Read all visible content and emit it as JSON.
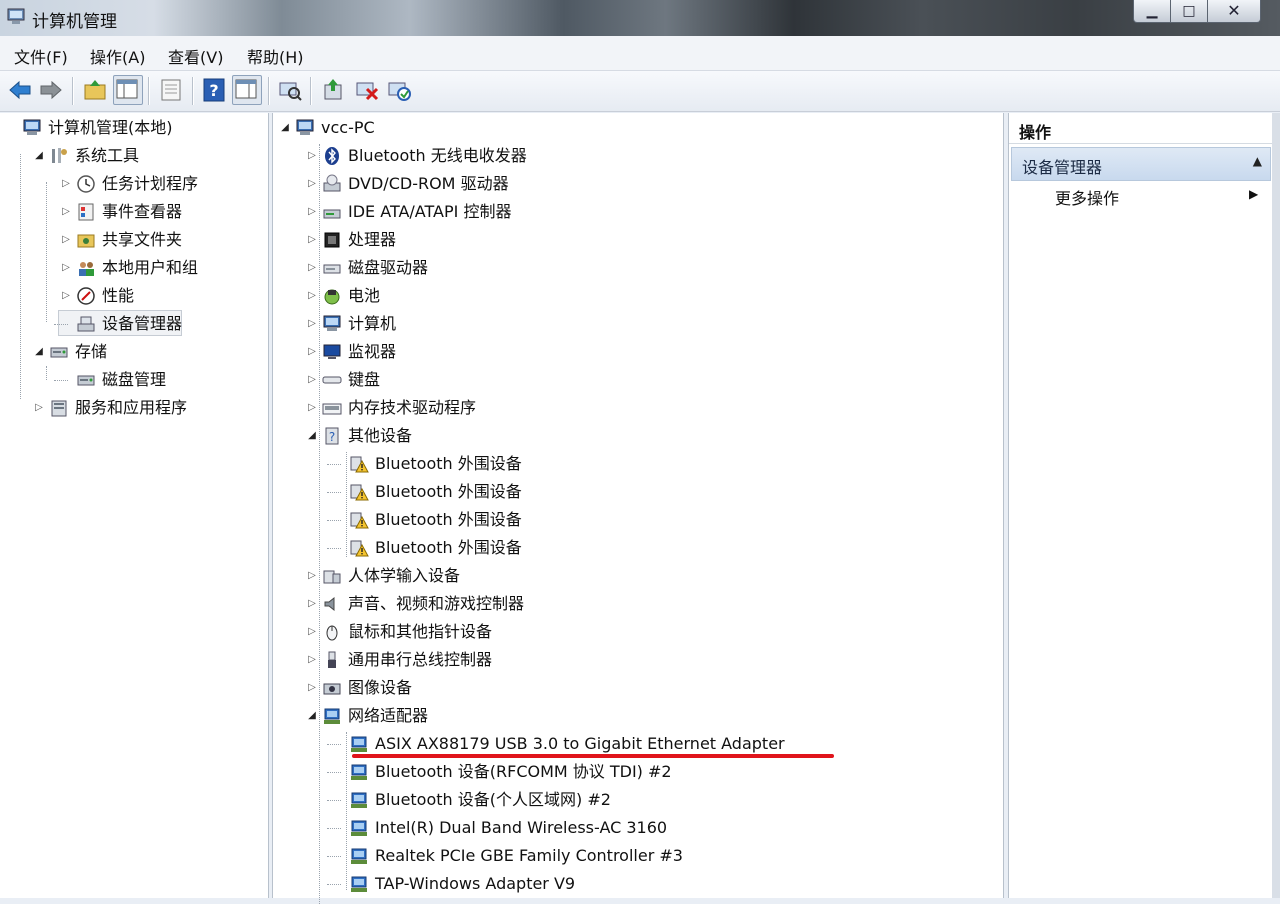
{
  "window": {
    "title": "计算机管理"
  },
  "menu": [
    "文件(F)",
    "操作(A)",
    "查看(V)",
    "帮助(H)"
  ],
  "left_tree": [
    {
      "label": "计算机管理(本地)",
      "icon": "computer-management-icon",
      "level": 0,
      "expander": "none"
    },
    {
      "label": "系统工具",
      "icon": "system-tools-icon",
      "level": 1,
      "expander": "open"
    },
    {
      "label": "任务计划程序",
      "icon": "clock-icon",
      "level": 2,
      "expander": "closed"
    },
    {
      "label": "事件查看器",
      "icon": "event-viewer-icon",
      "level": 2,
      "expander": "closed"
    },
    {
      "label": "共享文件夹",
      "icon": "shared-folder-icon",
      "level": 2,
      "expander": "closed"
    },
    {
      "label": "本地用户和组",
      "icon": "users-icon",
      "level": 2,
      "expander": "closed"
    },
    {
      "label": "性能",
      "icon": "performance-icon",
      "level": 2,
      "expander": "closed"
    },
    {
      "label": "设备管理器",
      "icon": "device-manager-icon",
      "level": 2,
      "expander": "none",
      "selected": true
    },
    {
      "label": "存储",
      "icon": "storage-icon",
      "level": 1,
      "expander": "open"
    },
    {
      "label": "磁盘管理",
      "icon": "disk-management-icon",
      "level": 2,
      "expander": "none"
    },
    {
      "label": "服务和应用程序",
      "icon": "services-icon",
      "level": 1,
      "expander": "closed"
    }
  ],
  "device_tree": [
    {
      "label": "vcc-PC",
      "icon": "computer-icon",
      "level": 0,
      "expander": "open"
    },
    {
      "label": "Bluetooth 无线电收发器",
      "icon": "bluetooth-icon",
      "level": 1,
      "expander": "closed"
    },
    {
      "label": "DVD/CD-ROM 驱动器",
      "icon": "dvd-drive-icon",
      "level": 1,
      "expander": "closed"
    },
    {
      "label": "IDE ATA/ATAPI 控制器",
      "icon": "ide-controller-icon",
      "level": 1,
      "expander": "closed"
    },
    {
      "label": "处理器",
      "icon": "processor-icon",
      "level": 1,
      "expander": "closed"
    },
    {
      "label": "磁盘驱动器",
      "icon": "disk-drive-icon",
      "level": 1,
      "expander": "closed"
    },
    {
      "label": "电池",
      "icon": "battery-icon",
      "level": 1,
      "expander": "closed"
    },
    {
      "label": "计算机",
      "icon": "computer-icon",
      "level": 1,
      "expander": "closed"
    },
    {
      "label": "监视器",
      "icon": "monitor-icon",
      "level": 1,
      "expander": "closed"
    },
    {
      "label": "键盘",
      "icon": "keyboard-icon",
      "level": 1,
      "expander": "closed"
    },
    {
      "label": "内存技术驱动程序",
      "icon": "memory-icon",
      "level": 1,
      "expander": "closed"
    },
    {
      "label": "其他设备",
      "icon": "unknown-device-icon",
      "level": 1,
      "expander": "open"
    },
    {
      "label": "Bluetooth 外围设备",
      "icon": "warning-device-icon",
      "level": 2,
      "expander": "none"
    },
    {
      "label": "Bluetooth 外围设备",
      "icon": "warning-device-icon",
      "level": 2,
      "expander": "none"
    },
    {
      "label": "Bluetooth 外围设备",
      "icon": "warning-device-icon",
      "level": 2,
      "expander": "none"
    },
    {
      "label": "Bluetooth 外围设备",
      "icon": "warning-device-icon",
      "level": 2,
      "expander": "none"
    },
    {
      "label": "人体学输入设备",
      "icon": "hid-icon",
      "level": 1,
      "expander": "closed"
    },
    {
      "label": "声音、视频和游戏控制器",
      "icon": "speaker-icon",
      "level": 1,
      "expander": "closed"
    },
    {
      "label": "鼠标和其他指针设备",
      "icon": "mouse-icon",
      "level": 1,
      "expander": "closed"
    },
    {
      "label": "通用串行总线控制器",
      "icon": "usb-icon",
      "level": 1,
      "expander": "closed"
    },
    {
      "label": "图像设备",
      "icon": "camera-icon",
      "level": 1,
      "expander": "closed"
    },
    {
      "label": "网络适配器",
      "icon": "network-adapter-icon",
      "level": 1,
      "expander": "open"
    },
    {
      "label": "ASIX AX88179 USB 3.0 to Gigabit Ethernet Adapter",
      "icon": "network-adapter-icon",
      "level": 2,
      "expander": "none",
      "highlighted": true
    },
    {
      "label": "Bluetooth 设备(RFCOMM 协议 TDI) #2",
      "icon": "network-adapter-icon",
      "level": 2,
      "expander": "none"
    },
    {
      "label": "Bluetooth 设备(个人区域网) #2",
      "icon": "network-adapter-icon",
      "level": 2,
      "expander": "none"
    },
    {
      "label": "Intel(R) Dual Band Wireless-AC 3160",
      "icon": "network-adapter-icon",
      "level": 2,
      "expander": "none"
    },
    {
      "label": "Realtek PCIe GBE Family Controller #3",
      "icon": "network-adapter-icon",
      "level": 2,
      "expander": "none"
    },
    {
      "label": "TAP-Windows Adapter V9",
      "icon": "network-adapter-icon",
      "level": 2,
      "expander": "none"
    }
  ],
  "actions": {
    "header": "操作",
    "section": "设备管理器",
    "more": "更多操作"
  },
  "colors": {
    "highlight_underline": "#e0141b",
    "section_bg": "#c8d9ee"
  }
}
